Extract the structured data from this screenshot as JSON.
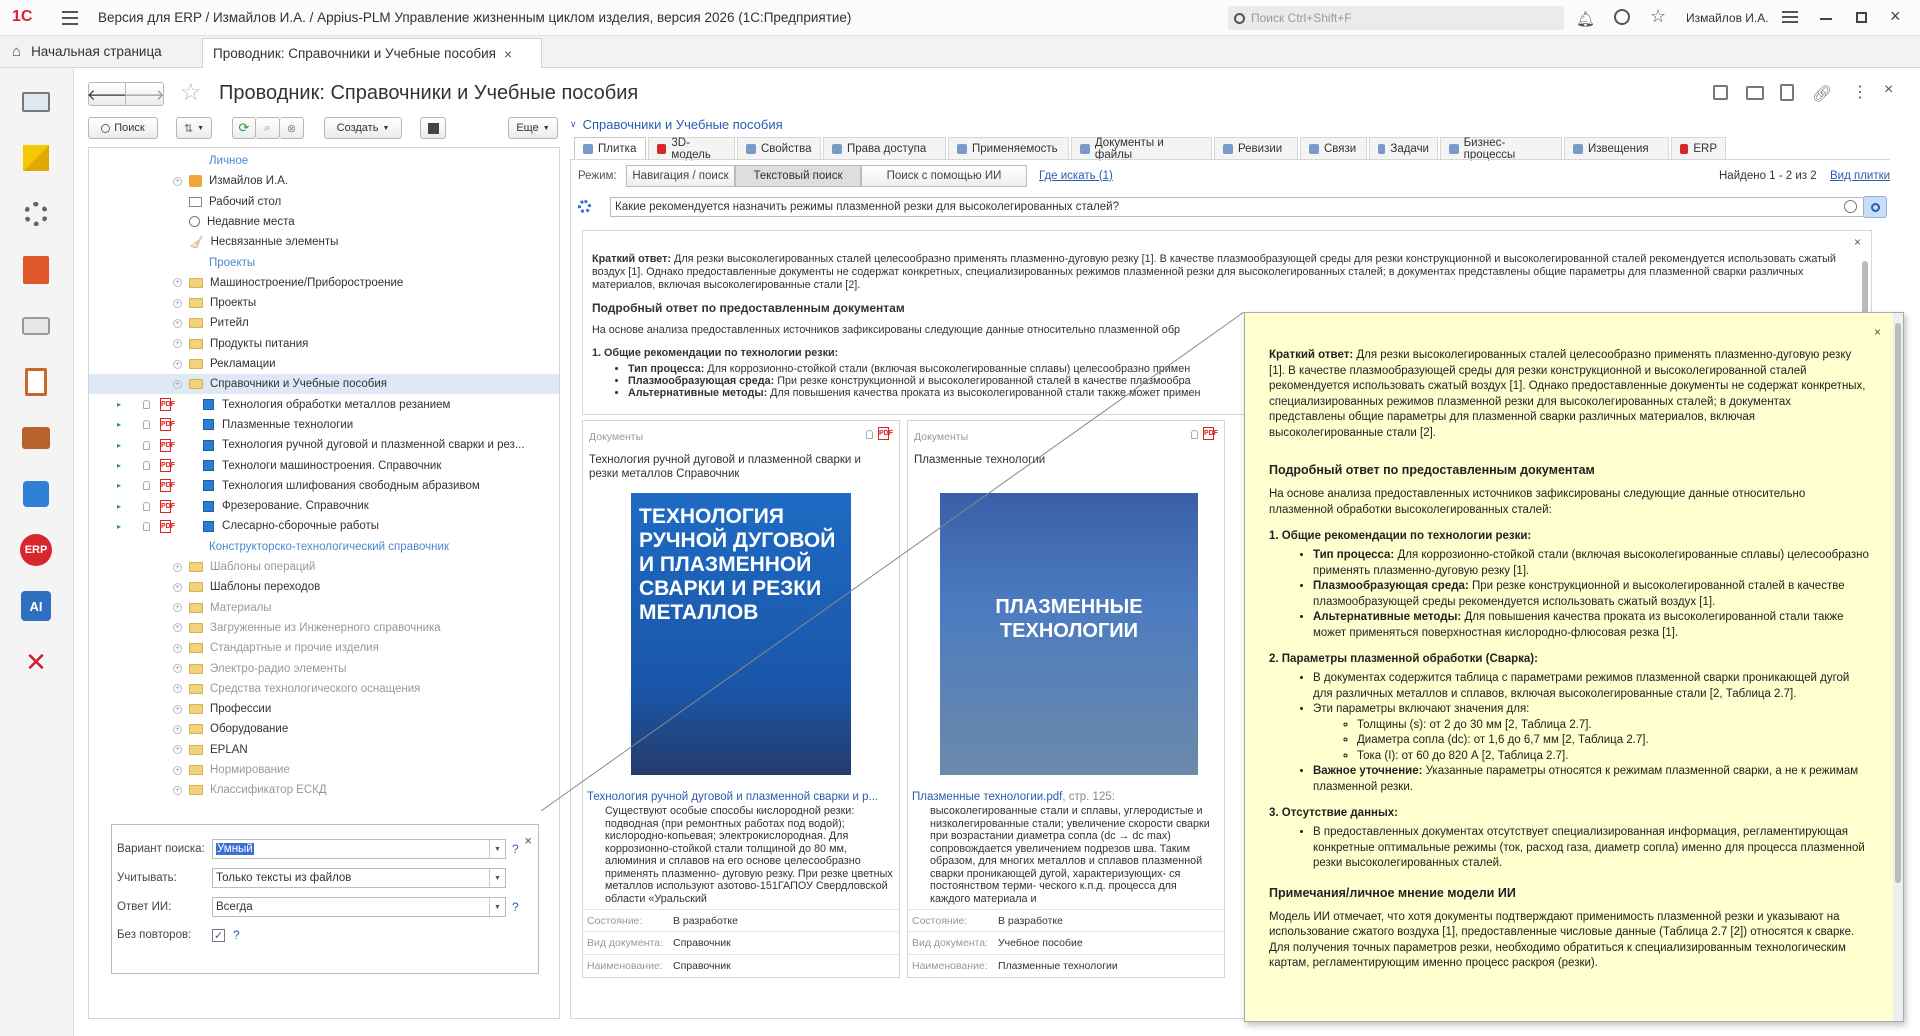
{
  "app": {
    "title": "Версия для ERP / Измайлов И.А. / Appius-PLM Управление жизненным циклом изделия, версия 2026  (1С:Предприятие)",
    "search_placeholder": "Поиск Ctrl+Shift+F",
    "user": "Измайлов И.А.",
    "logo": "1С"
  },
  "tabs": {
    "home": "Начальная страница",
    "current": "Проводник: Справочники и Учебные пособия"
  },
  "sidebar": {
    "icons": [
      "monitor-icon",
      "blocks-icon",
      "gears-icon",
      "box-icon",
      "printer-icon",
      "clipboard-icon",
      "briefcase-icon",
      "puzzle-icon",
      "erp-icon",
      "ai-icon",
      "tools-icon"
    ],
    "erp_label": "ERP",
    "ai_label": "AI"
  },
  "page": {
    "title": "Проводник: Справочники и Учебные пособия"
  },
  "toolbar": {
    "search": "Поиск",
    "create": "Создать",
    "more": "Еще"
  },
  "tree": [
    {
      "label": "Личное",
      "type": "section",
      "indent": 0
    },
    {
      "label": "Измайлов И.А.",
      "type": "user",
      "indent": 1
    },
    {
      "label": "Рабочий стол",
      "type": "desk",
      "indent": 1
    },
    {
      "label": "Недавние места",
      "type": "recent",
      "indent": 1
    },
    {
      "label": "Несвязанные элементы",
      "type": "broom",
      "indent": 1
    },
    {
      "label": "Проекты",
      "type": "section",
      "indent": 0
    },
    {
      "label": "Машиностроение/Приборостроение",
      "type": "folder",
      "indent": 1
    },
    {
      "label": "Проекты",
      "type": "folder",
      "indent": 1
    },
    {
      "label": "Ритейл",
      "type": "folder",
      "indent": 1
    },
    {
      "label": "Продукты питания",
      "type": "folder",
      "indent": 1
    },
    {
      "label": "Рекламации",
      "type": "folder",
      "indent": 1
    },
    {
      "label": "Справочники и Учебные пособия",
      "type": "folder",
      "indent": 1,
      "selected": true
    },
    {
      "label": "Технология обработки металлов резанием",
      "type": "doc",
      "indent": 2
    },
    {
      "label": "Плазменные технологии",
      "type": "doc",
      "indent": 2
    },
    {
      "label": "Технология ручной дуговой и плазменной сварки и рез...",
      "type": "doc",
      "indent": 2
    },
    {
      "label": "Технологи машиностроения. Справочник",
      "type": "doc",
      "indent": 2
    },
    {
      "label": "Технология шлифования свободным абразивом",
      "type": "doc",
      "indent": 2
    },
    {
      "label": "Фрезерование. Справочник",
      "type": "doc",
      "indent": 2
    },
    {
      "label": "Слесарно-сборочные работы",
      "type": "doc",
      "indent": 2
    },
    {
      "label": "Конструкторско-технологический справочник",
      "type": "section",
      "indent": 0
    },
    {
      "label": "Шаблоны операций",
      "type": "folder",
      "indent": 1,
      "dim": true
    },
    {
      "label": "Шаблоны переходов",
      "type": "folder",
      "indent": 1
    },
    {
      "label": "Материалы",
      "type": "folder",
      "indent": 1,
      "dim": true
    },
    {
      "label": "Загруженные из Инженерного справочника",
      "type": "folder",
      "indent": 1,
      "dim": true
    },
    {
      "label": "Стандартные и прочие изделия",
      "type": "folder",
      "indent": 1,
      "dim": true
    },
    {
      "label": "Электро-радио элементы",
      "type": "folder",
      "indent": 1,
      "dim": true
    },
    {
      "label": "Средства технологического оснащения",
      "type": "folder",
      "indent": 1,
      "dim": true
    },
    {
      "label": "Профессии",
      "type": "folder",
      "indent": 1
    },
    {
      "label": "Оборудование",
      "type": "folder",
      "indent": 1
    },
    {
      "label": "EPLAN",
      "type": "folder",
      "indent": 1
    },
    {
      "label": "Нормирование",
      "type": "folder",
      "indent": 1,
      "dim": true
    },
    {
      "label": "Классификатор ЕСКД",
      "type": "folder",
      "indent": 1,
      "dim": true
    }
  ],
  "filter": {
    "variant_label": "Вариант поиска:",
    "variant_value": "Умный",
    "consider_label": "Учитывать:",
    "consider_value": "Только тексты из файлов",
    "ai_label": "Ответ ИИ:",
    "ai_value": "Всегда",
    "norepeat_label": "Без повторов:",
    "q": "?"
  },
  "right": {
    "breadcrumb": "Справочники и Учебные пособия",
    "tabs": [
      "Плитка",
      "3D-модель",
      "Свойства",
      "Права доступа",
      "Применяемость",
      "Документы и файлы",
      "Ревизии",
      "Связи",
      "Задачи",
      "Бизнес-процессы",
      "Извещения",
      "ERP"
    ],
    "mode_label": "Режим:",
    "modes": [
      "Навигация / поиск",
      "Текстовый поиск",
      "Поиск с помощью ИИ"
    ],
    "where": "Где искать (1)",
    "found": "Найдено 1 - 2 из 2",
    "view": "Вид плитки",
    "query": "Какие рекомендуется назначить режимы плазменной резки для высоколегированных сталей?"
  },
  "answer_short": {
    "label": "Краткий ответ:",
    "text": " Для резки высоколегированных сталей целесообразно применять плазменно-дуговую резку [1]. В качестве плазмообразующей среды для резки конструкционной и высоколегированной сталей рекомендуется использовать сжатый воздух [1]. Однако предоставленные документы не содержат конкретных, специализированных режимов плазменной резки для высоколегированных сталей; в документах представлены общие параметры для плазменной сварки различных материалов, включая высоколегированные стали [2].",
    "h_detail": "Подробный ответ по предоставленным документам",
    "intro": "На основе анализа предоставленных источников зафиксированы следующие данные относительно плазменной обр",
    "h1": "1. Общие рекомендации по технологии резки:",
    "b1k": "Тип процесса:",
    "b1": " Для коррозионно-стойкой стали (включая высоколегированные сплавы) целесообразно примен",
    "b2k": "Плазмообразующая среда:",
    "b2": " При резке конструкционной и высоколегированной сталей в качестве плазмообра",
    "b3k": "Альтернативные методы:",
    "b3": " Для повышения качества проката из высоколегированной стали также может примен"
  },
  "cards": [
    {
      "caption": "Документы",
      "title": "Технология ручной дуговой и плазменной сварки и резки металлов Справочник",
      "cover_text": "ТЕХНОЛОГИЯ РУЧНОЙ ДУГОВОЙ И ПЛАЗМЕННОЙ СВАРКИ И РЕЗКИ МЕТАЛЛОВ",
      "link": "Технология ручной дуговой и плазменной сварки и р...",
      "snippet": "Существуют особые способы кислородной резки: подводная (при ремонтных работах под водой); кислородно-копьевая; электрокислородная. Для коррозионно-стойкой стали толщиной до 80 мм, алюминия и сплавов на его основе целесообразно применять плазменно- дуговую резку. При резке цветных металлов используют азотово-151ГАПОУ Свердловской области «Уральский",
      "status_k": "Состояние:",
      "status": "В разработке",
      "type_k": "Вид документа:",
      "type": "Справочник",
      "name_k": "Наименование:",
      "name": "Справочник"
    },
    {
      "caption": "Документы",
      "title": "Плазменные технологии",
      "cover_text": "ПЛАЗМЕННЫЕ ТЕХНОЛОГИИ",
      "link": "Плазменные технологии.pdf",
      "page": ", стр. 125:",
      "snippet": "высоколегированные стали и сплавы, углеродистые и низколегированные стали; увеличение скорости сварки при возрастании диаметра сопла (dc → dc max) сопровождается увеличением подрезов шва. Таким образом, для многих металлов и сплавов плазменной сварки проникающей дугой, характеризующих- ся постоянством терми- ческого к.п.д. процесса для каждого материала и",
      "status_k": "Состояние:",
      "status": "В разработке",
      "type_k": "Вид документа:",
      "type": "Учебное пособие",
      "name_k": "Наименование:",
      "name": "Плазменные технологии"
    }
  ],
  "popup": {
    "short_label": "Краткий ответ:",
    "short": " Для резки высоколегированных сталей целесообразно применять плазменно-дуговую резку [1]. В качестве плазмообразующей среды для резки конструкционной и высоколегированной сталей рекомендуется использовать сжатый воздух [1]. Однако предоставленные документы не содержат конкретных, специализированных режимов плазменной резки для высоколегированных сталей; в документах представлены общие параметры для плазменной сварки различных материалов, включая высоколегированные стали [2].",
    "h_detail": "Подробный ответ по предоставленным документам",
    "intro": "На основе анализа предоставленных источников зафиксированы следующие данные относительно плазменной обработки высоколегированных сталей:",
    "h1": "1. Общие рекомендации по технологии резки:",
    "s1": [
      {
        "k": "Тип процесса:",
        "v": " Для коррозионно-стойкой стали (включая высоколегированные сплавы) целесообразно применять плазменно-дуговую резку [1]."
      },
      {
        "k": "Плазмообразующая среда:",
        "v": " При резке конструкционной и высоколегированной сталей в качестве плазмообразующей среды рекомендуется использовать сжатый воздух [1]."
      },
      {
        "k": "Альтернативные методы:",
        "v": " Для повышения качества проката из высоколегированной стали также может применяться поверхностная кислородно-флюсовая резка [1]."
      }
    ],
    "h2": "2. Параметры плазменной обработки (Сварка):",
    "s2a": "В документах содержится таблица с параметрами режимов плазменной сварки проникающей дугой для различных металлов и сплавов, включая высоколегированные стали [2, Таблица 2.7].",
    "s2b": "Эти параметры включают значения для:",
    "s2sub": [
      "Толщины (s): от 2 до 30 мм [2, Таблица 2.7].",
      "Диаметра сопла (dc): от 1,6 до 6,7 мм [2, Таблица 2.7].",
      "Тока (I): от 60 до 820 А [2, Таблица 2.7]."
    ],
    "s2ck": "Важное уточнение:",
    "s2c": " Указанные параметры относятся к режимам плазменной сварки, а не к режимам плазменной резки.",
    "h3": "3. Отсутствие данных:",
    "s3": "В предоставленных документах отсутствует специализированная информация, регламентирующая конкретные оптимальные режимы (ток, расход газа, диаметр сопла) именно для процесса плазменной резки высоколегированных сталей.",
    "h_notes": "Примечания/личное мнение модели ИИ",
    "notes": "Модель ИИ отмечает, что хотя документы подтверждают применимость плазменной резки и указывают на использование сжатого воздуха [1], предоставленные числовые данные (Таблица 2.7 [2]) относятся к сварке. Для получения точных параметров резки, необходимо обратиться к специализированным технологическим картам, регламентирующим именно процесс раскроя (резки)."
  }
}
